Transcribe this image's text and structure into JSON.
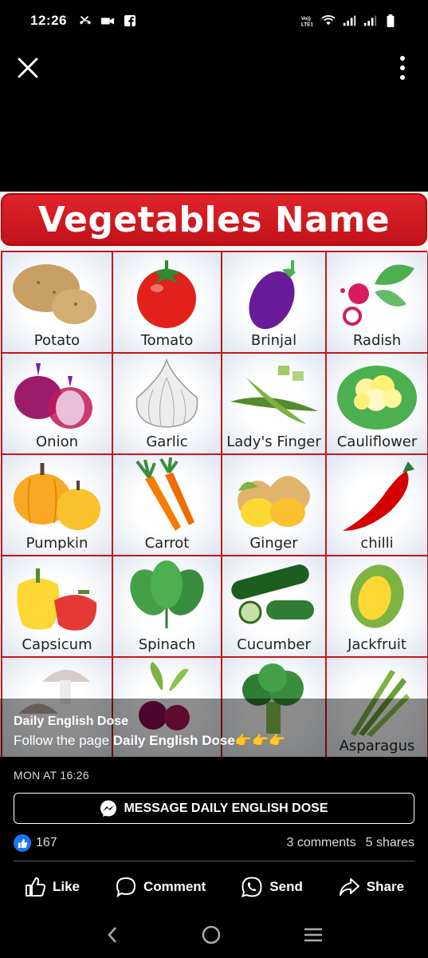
{
  "status_bar": {
    "time": "12:26",
    "left_icons": [
      "missed-call-icon",
      "video-icon",
      "facebook-icon"
    ],
    "right_icons": [
      "volte-icon",
      "wifi-icon",
      "signal-icon",
      "signal-icon",
      "battery-icon"
    ],
    "volte_text": "Vo)) LTE1"
  },
  "post_image": {
    "title": "Vegetables Name",
    "vegetables": [
      {
        "label": "Potato",
        "icon": "potato-icon"
      },
      {
        "label": "Tomato",
        "icon": "tomato-icon"
      },
      {
        "label": "Brinjal",
        "icon": "brinjal-icon"
      },
      {
        "label": "Radish",
        "icon": "radish-icon"
      },
      {
        "label": "Onion",
        "icon": "onion-icon"
      },
      {
        "label": "Garlic",
        "icon": "garlic-icon"
      },
      {
        "label": "Lady's Finger",
        "icon": "ladys-finger-icon"
      },
      {
        "label": "Cauliflower",
        "icon": "cauliflower-icon"
      },
      {
        "label": "Pumpkin",
        "icon": "pumpkin-icon"
      },
      {
        "label": "Carrot",
        "icon": "carrot-icon"
      },
      {
        "label": "Ginger",
        "icon": "ginger-icon"
      },
      {
        "label": "chilli",
        "icon": "chilli-icon"
      },
      {
        "label": "Capsicum",
        "icon": "capsicum-icon"
      },
      {
        "label": "Spinach",
        "icon": "spinach-icon"
      },
      {
        "label": "Cucumber",
        "icon": "cucumber-icon"
      },
      {
        "label": "Jackfruit",
        "icon": "jackfruit-icon"
      },
      {
        "label": "",
        "icon": "mushroom-icon"
      },
      {
        "label": "",
        "icon": "beetroot-icon"
      },
      {
        "label": "",
        "icon": "broccoli-icon"
      },
      {
        "label": "Asparagus",
        "icon": "asparagus-icon"
      }
    ]
  },
  "overlay": {
    "page_name": "Daily English Dose",
    "follow_prefix": "Follow the page ",
    "follow_page": "Daily English Dose",
    "emoji": "👉👉👉"
  },
  "post": {
    "timestamp": "MON AT 16:26",
    "message_button": "MESSAGE DAILY ENGLISH DOSE",
    "like_count": "167",
    "comments": "3 comments",
    "shares": "5 shares"
  },
  "actions": {
    "like": "Like",
    "comment": "Comment",
    "send": "Send",
    "share": "Share"
  },
  "colors": {
    "banner_red": "#d61c23",
    "facebook_blue": "#1877f2",
    "grid_border": "#c8161d"
  }
}
